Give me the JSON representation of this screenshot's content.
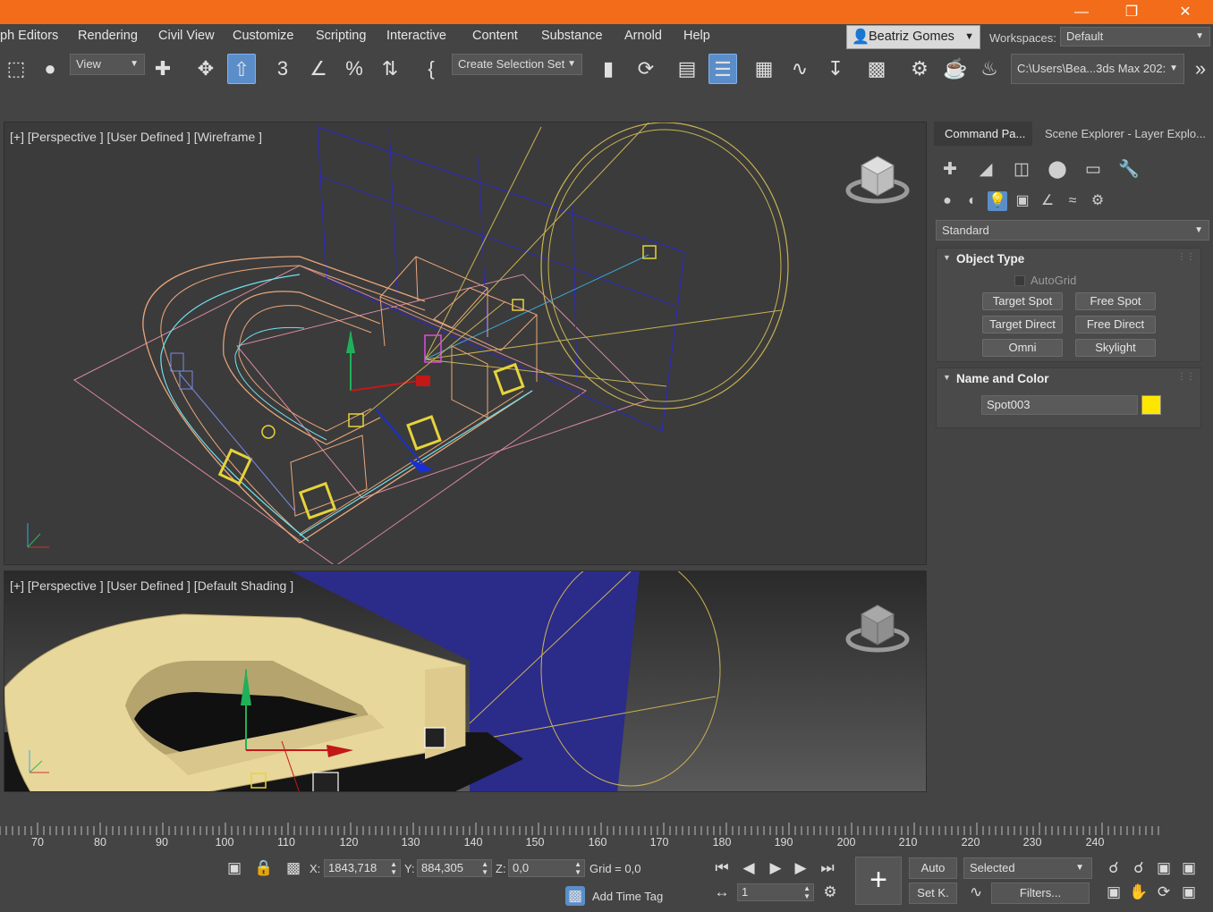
{
  "colors": {
    "titlebar": "#f36c19",
    "accent": "#5b8ec9",
    "light_color": "#ffe600"
  },
  "menu": {
    "items": [
      "ph Editors",
      "Rendering",
      "Civil View",
      "Customize",
      "Scripting",
      "Interactive",
      "Content",
      "Substance",
      "Arnold",
      "Help"
    ]
  },
  "user": {
    "name": "Beatriz Gomes"
  },
  "workspace": {
    "label": "Workspaces:",
    "value": "Default"
  },
  "toolbar": {
    "view_dropdown": "View",
    "selection_set": "Create Selection Set",
    "project_path": "C:\\Users\\Bea...3ds Max 202:"
  },
  "viewports": {
    "top_label": "[+] [Perspective ] [User Defined ] [Wireframe ]",
    "bottom_label": "[+] [Perspective ] [User Defined ] [Default Shading ]"
  },
  "command_panel": {
    "tabs": [
      "Command Pa...",
      "Scene Explorer - Layer Explo..."
    ],
    "category": "Standard",
    "object_type": {
      "title": "Object Type",
      "autogrid": "AutoGrid",
      "buttons": [
        "Target Spot",
        "Free Spot",
        "Target Direct",
        "Free Direct",
        "Omni",
        "Skylight"
      ]
    },
    "name_color": {
      "title": "Name and Color",
      "name": "Spot003"
    }
  },
  "timeline": {
    "ticks": [
      "70",
      "80",
      "90",
      "100",
      "110",
      "120",
      "130",
      "140",
      "150",
      "160",
      "170",
      "180",
      "190",
      "200",
      "210",
      "220",
      "230",
      "240"
    ]
  },
  "status": {
    "x_label": "X:",
    "x_value": "1843,718",
    "y_label": "Y:",
    "y_value": "884,305",
    "z_label": "Z:",
    "z_value": "0,0",
    "grid": "Grid = 0,0",
    "add_time_tag": "Add Time Tag",
    "frame": "1",
    "auto_key": "Auto",
    "set_key": "Set K.",
    "key_filter": "Selected",
    "filters": "Filters..."
  }
}
